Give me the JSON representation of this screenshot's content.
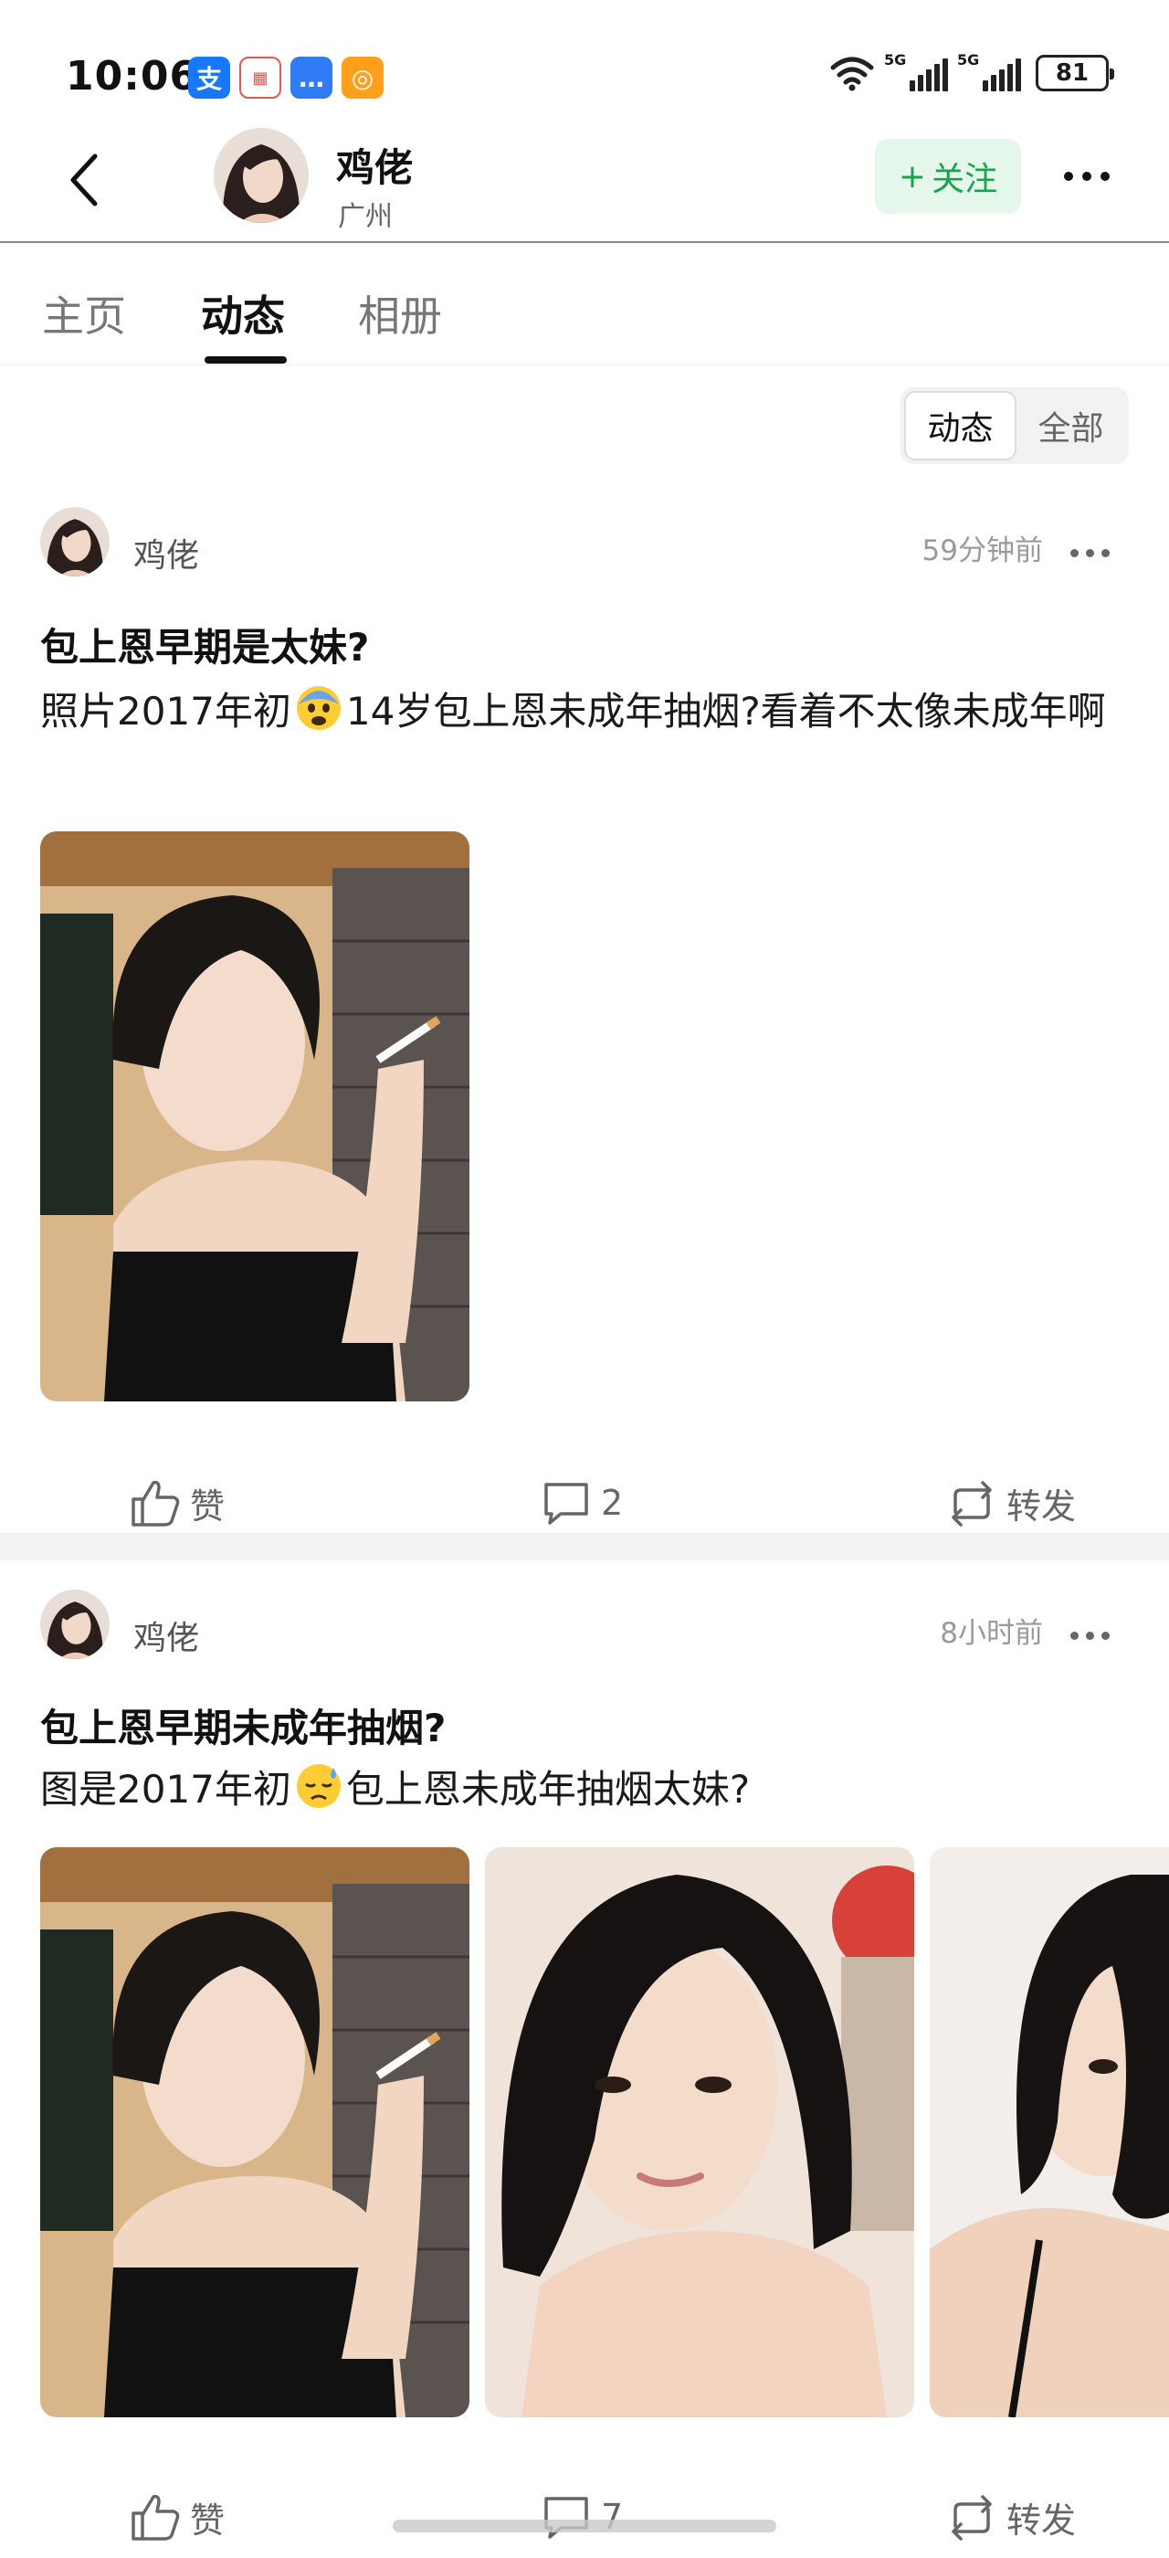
{
  "status_bar": {
    "time": "10:06",
    "notification_icons": [
      "alipay-icon",
      "calendar-icon",
      "message-icon",
      "search-app-icon"
    ],
    "signal_1_label": "5G",
    "signal_2_label": "5G",
    "battery": "81"
  },
  "header": {
    "name": "鸡佬",
    "location": "广州",
    "follow_plus": "+",
    "follow_label": "关注"
  },
  "tabs": [
    {
      "label": "主页"
    },
    {
      "label": "动态"
    },
    {
      "label": "相册"
    }
  ],
  "filter": {
    "options": [
      "动态",
      "全部"
    ],
    "selected": "动态"
  },
  "posts": [
    {
      "author": "鸡佬",
      "time": "59分钟前",
      "title": "包上恩早期是太妹?",
      "body_before": "照片2017年初",
      "emoji": "anxious-face-emoji",
      "body_after": "14岁包上恩未成年抽烟?看着不太像未成年啊",
      "images": [
        "smoking-photo"
      ],
      "like_label": "赞",
      "comment_count": "2",
      "share_label": "转发"
    },
    {
      "author": "鸡佬",
      "time": "8小时前",
      "title": "包上恩早期未成年抽烟?",
      "body_before": "图是2017年初",
      "emoji": "downcast-sweat-face-emoji",
      "body_after": "包上恩未成年抽烟太妹?",
      "images": [
        "smoking-photo",
        "portrait-photo",
        "side-profile-photo"
      ],
      "like_label": "赞",
      "comment_count": "7",
      "share_label": "转发"
    }
  ]
}
